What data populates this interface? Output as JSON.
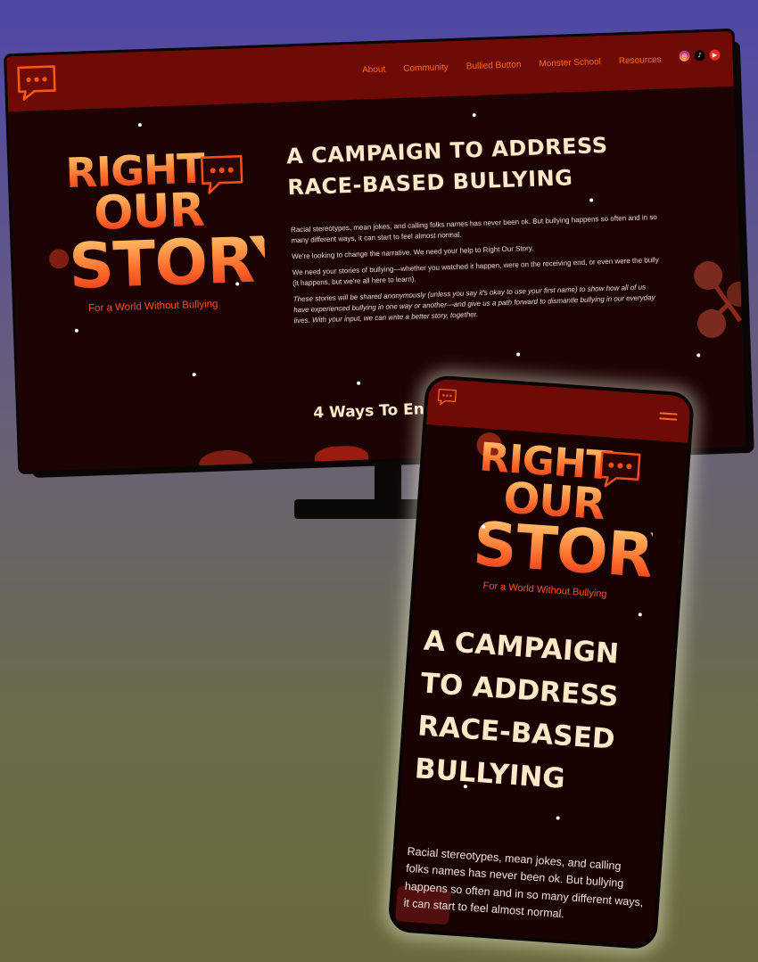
{
  "site": {
    "brand": {
      "line1": "RIGHT",
      "line2": "OUR",
      "line3": "STORY",
      "tagline": "For a World Without Bullying"
    },
    "nav": {
      "links": [
        {
          "label": "About"
        },
        {
          "label": "Community"
        },
        {
          "label": "Bullied Button"
        },
        {
          "label": "Monster School"
        },
        {
          "label": "Resources"
        }
      ],
      "social": [
        {
          "icon": "instagram-icon",
          "glyph": "◎"
        },
        {
          "icon": "tiktok-icon",
          "glyph": "♪"
        },
        {
          "icon": "youtube-icon",
          "glyph": "▶"
        }
      ]
    },
    "hero": {
      "title": "A Campaign to Address Race-Based Bullying",
      "paragraphs": [
        "Racial stereotypes, mean jokes, and calling folks names has never been ok. But bullying happens so often and in so many different ways, it can start to feel almost normal.",
        "We're looking to change the narrative. We need your help to Right Our Story.",
        "We need your stories of bullying—whether you watched it happen, were on the receiving end, or even were the bully (it happens, but we're all here to learn).",
        "These stories will be shared anonymously (unless you say it's okay to use your first name) to show how all of us have experienced bullying in one way or another—and give us a path forward to dismantle bullying in our everyday lives. With your input, we can write a better story, together."
      ]
    },
    "engage_heading": "4 Ways To Engag"
  },
  "phone": {
    "title": "A Campaign to Address Race-Based Bullying",
    "body": "Racial stereotypes, mean jokes, and calling folks names has never been ok. But bullying happens so often and in so many different ways, it can start to feel almost normal."
  },
  "colors": {
    "background_top": "#4f48a6",
    "background_bottom": "#6b6a3c",
    "nav": "#6e0b06",
    "page": "#1d0404",
    "accent": "#ff6a1a",
    "title": "#ffe8c8"
  }
}
